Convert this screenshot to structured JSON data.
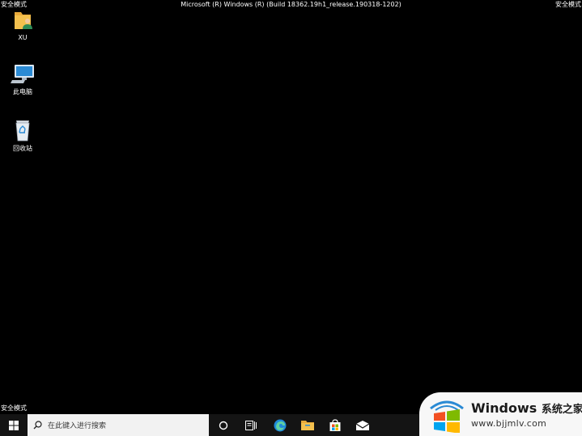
{
  "mode": {
    "top_left": "安全模式",
    "top_right": "安全模式",
    "bottom_left": "安全模式"
  },
  "build_text": "Microsoft (R) Windows (R) (Build 18362.19h1_release.190318-1202)",
  "desktop": {
    "icons": [
      {
        "label": "XU",
        "icon": "user-folder-icon"
      },
      {
        "label": "此电脑",
        "icon": "this-pc-icon"
      },
      {
        "label": "回收站",
        "icon": "recycle-bin-icon"
      }
    ]
  },
  "taskbar": {
    "search_placeholder": "在此键入进行搜索",
    "apps": [
      "cortana-icon",
      "task-view-icon",
      "edge-icon",
      "file-explorer-icon",
      "store-icon",
      "mail-icon"
    ]
  },
  "watermark": {
    "brand": "Windows",
    "brand_suffix": "系统之家",
    "url": "www.bjjmlv.com"
  },
  "colors": {
    "desktop_bg": "#000000",
    "taskbar_bg": "#141414",
    "search_bg": "#f2f2f2",
    "edge_blue": "#1f8ad9",
    "folder_yellow": "#f3c04e",
    "store_blue": "#2b7fd9"
  }
}
